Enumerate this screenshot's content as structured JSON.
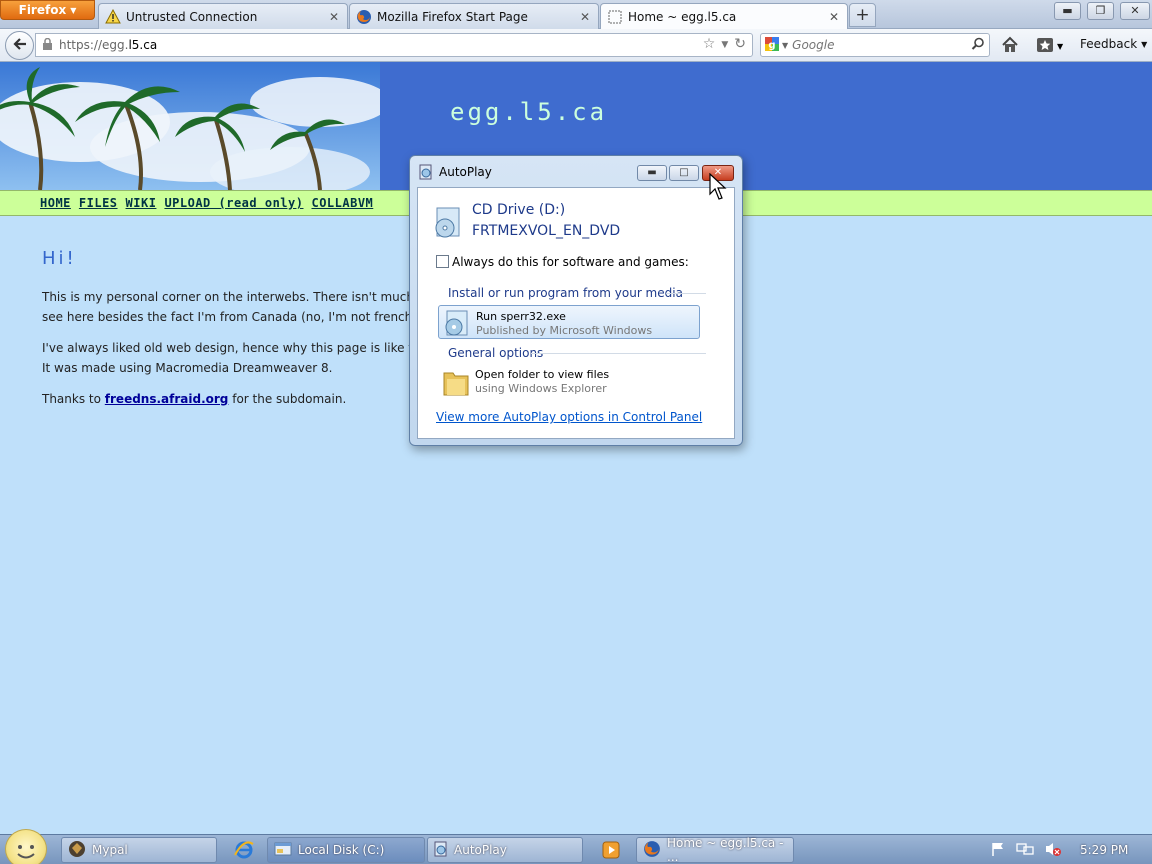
{
  "browser": {
    "app_button": "Firefox",
    "tabs": [
      {
        "label": "Untrusted Connection",
        "icon": "warning-icon"
      },
      {
        "label": "Mozilla Firefox Start Page",
        "icon": "firefox-icon"
      },
      {
        "label": "Home ~ egg.l5.ca",
        "icon": "blank-page-icon",
        "active": true
      }
    ],
    "new_tab": "+",
    "url_scheme": "https://egg.",
    "url_host": "l5.ca",
    "search_placeholder": "Google",
    "feedback_label": "Feedback"
  },
  "site": {
    "title": "egg.l5.ca",
    "nav": [
      "HOME",
      "FILES",
      "WIKI",
      "UPLOAD (read only)",
      "COLLABVM"
    ],
    "greeting": "Hi!",
    "p1": "This is my personal corner on the interwebs. There isn't much to see here besides the fact I'm from Canada (no, I'm not french.)",
    "p2": "I've always liked old web design, hence why this page is like this. It was made using Macromedia Dreamweaver 8.",
    "p3_before": "Thanks to",
    "p3_link": "freedns.afraid.org",
    "p3_after": "for the subdomain."
  },
  "autoplay": {
    "title": "AutoPlay",
    "drive_name": "CD Drive (D:)",
    "drive_label": "FRTMEXVOL_EN_DVD",
    "always_label": "Always do this for software and games:",
    "always_checked": false,
    "section_install": "Install or run program from your media",
    "run_title": "Run sperr32.exe",
    "run_sub": "Published by Microsoft Windows",
    "section_general": "General options",
    "folder_title": "Open folder to view files",
    "folder_sub": "using Windows Explorer",
    "more_link": "View more AutoPlay options in Control Panel"
  },
  "taskbar": {
    "items": [
      "Mypal",
      "Local Disk (C:)",
      "AutoPlay",
      "Home ~ egg.l5.ca - ..."
    ],
    "clock": "5:29 PM"
  },
  "colors": {
    "site_header": "#3f6ccf",
    "site_nav": "#ccff99",
    "page_bg": "#bfe0fa",
    "firefox_orange": "#e06a10"
  }
}
